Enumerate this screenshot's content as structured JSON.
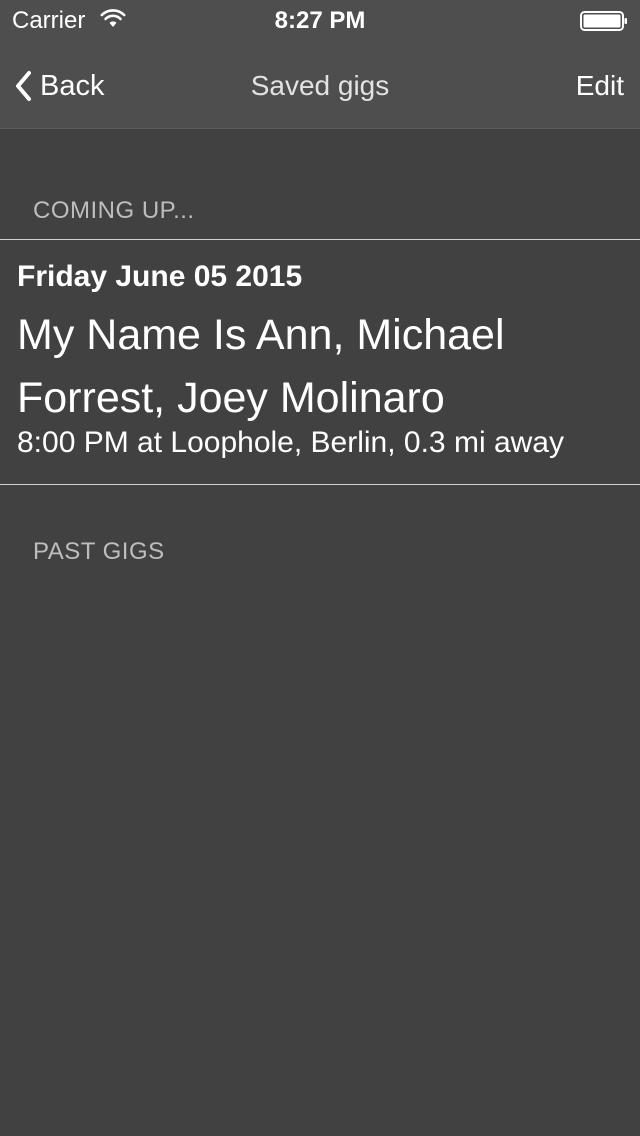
{
  "status_bar": {
    "carrier": "Carrier",
    "time": "8:27 PM",
    "wifi_icon": "wifi-icon",
    "battery_icon": "battery-icon"
  },
  "nav": {
    "back_label": "Back",
    "back_icon": "chevron-left-icon",
    "title": "Saved gigs",
    "edit_label": "Edit"
  },
  "sections": {
    "upcoming_header": "COMING UP...",
    "past_header": "PAST GIGS"
  },
  "upcoming_gigs": [
    {
      "date": "Friday June 05 2015",
      "artists": "My Name Is Ann, Michael Forrest, Joey Molinaro",
      "details": "8:00 PM at Loophole, Berlin, 0.3 mi away"
    }
  ],
  "colors": {
    "background": "#414141",
    "bar_background": "#4e4e4e",
    "section_header_text": "#bdbdbd",
    "separator": "#cfcfcf"
  }
}
